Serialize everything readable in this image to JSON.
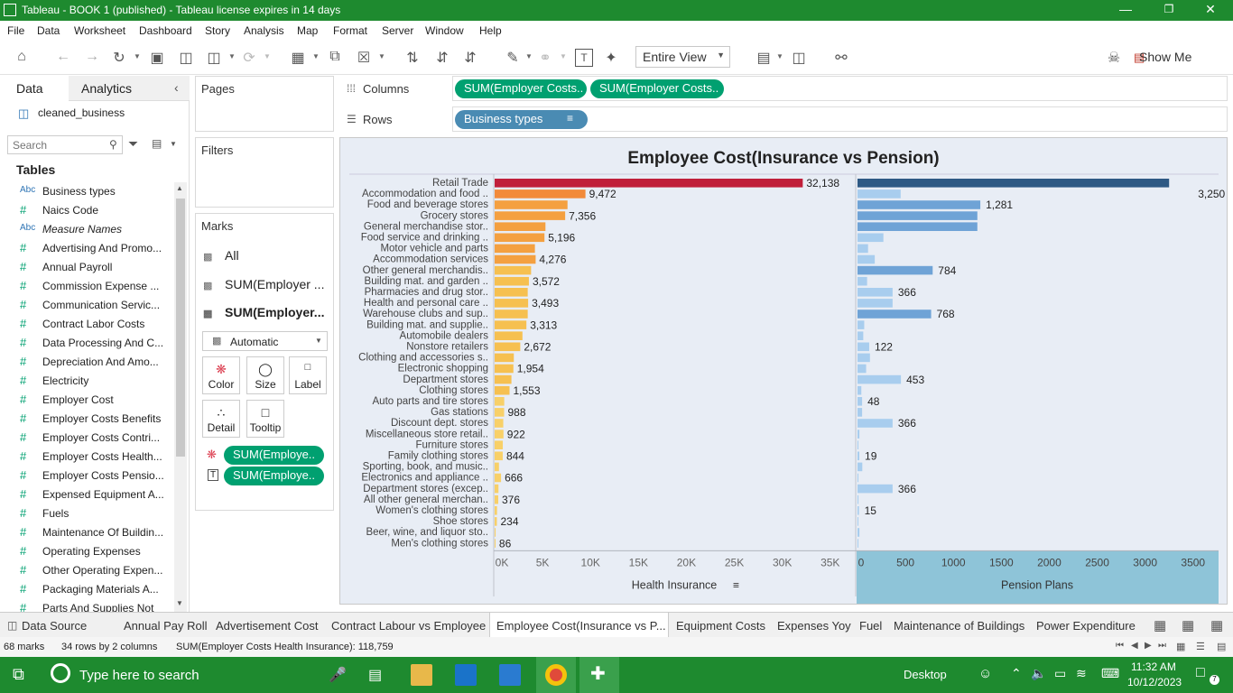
{
  "titlebar": {
    "title": "Tableau - BOOK 1 (published) - Tableau license expires in 14 days"
  },
  "menu": [
    "File",
    "Data",
    "Worksheet",
    "Dashboard",
    "Story",
    "Analysis",
    "Map",
    "Format",
    "Server",
    "Window",
    "Help"
  ],
  "toolbar": {
    "view_mode": "Entire View",
    "show_me": "Show Me"
  },
  "left": {
    "tab_data": "Data",
    "tab_analytics": "Analytics",
    "datasource": "cleaned_business",
    "search_placeholder": "Search",
    "tables_heading": "Tables",
    "fields": [
      {
        "icon": "Abc",
        "name": "Business types",
        "italic": false
      },
      {
        "icon": "#",
        "name": "Naics Code",
        "italic": false
      },
      {
        "icon": "Abc",
        "name": "Measure Names",
        "italic": true
      },
      {
        "icon": "#",
        "name": "Advertising And Promo...",
        "italic": false
      },
      {
        "icon": "#",
        "name": "Annual Payroll",
        "italic": false
      },
      {
        "icon": "#",
        "name": "Commission Expense ...",
        "italic": false
      },
      {
        "icon": "#",
        "name": "Communication Servic...",
        "italic": false
      },
      {
        "icon": "#",
        "name": "Contract Labor Costs",
        "italic": false
      },
      {
        "icon": "#",
        "name": "Data Processing And C...",
        "italic": false
      },
      {
        "icon": "#",
        "name": "Depreciation And Amo...",
        "italic": false
      },
      {
        "icon": "#",
        "name": "Electricity",
        "italic": false
      },
      {
        "icon": "#",
        "name": "Employer Cost",
        "italic": false
      },
      {
        "icon": "#",
        "name": "Employer Costs Benefits",
        "italic": false
      },
      {
        "icon": "#",
        "name": "Employer Costs Contri...",
        "italic": false
      },
      {
        "icon": "#",
        "name": "Employer Costs Health...",
        "italic": false
      },
      {
        "icon": "#",
        "name": "Employer Costs Pensio...",
        "italic": false
      },
      {
        "icon": "#",
        "name": "Expensed Equipment A...",
        "italic": false
      },
      {
        "icon": "#",
        "name": "Fuels",
        "italic": false
      },
      {
        "icon": "#",
        "name": "Maintenance Of Buildin...",
        "italic": false
      },
      {
        "icon": "#",
        "name": "Operating Expenses",
        "italic": false
      },
      {
        "icon": "#",
        "name": "Other Operating Expen...",
        "italic": false
      },
      {
        "icon": "#",
        "name": "Packaging Materials A...",
        "italic": false
      },
      {
        "icon": "#",
        "name": "Parts And Supplies Not",
        "italic": false
      }
    ]
  },
  "cards": {
    "pages": "Pages",
    "filters": "Filters",
    "marks": "Marks",
    "marks_all": "All",
    "marks_sum1": "SUM(Employer ...",
    "marks_sum2": "SUM(Employer...",
    "mark_type": "Automatic",
    "buttons": {
      "color": "Color",
      "size": "Size",
      "label": "Label",
      "detail": "Detail",
      "tooltip": "Tooltip"
    },
    "pill1": "SUM(Employe..",
    "pill2": "SUM(Employe.."
  },
  "shelves": {
    "columns_label": "Columns",
    "rows_label": "Rows",
    "col_pill1": "SUM(Employer Costs..",
    "col_pill2": "SUM(Employer Costs..",
    "row_pill": "Business types"
  },
  "chart_data": {
    "type": "bar",
    "title": "Employee Cost(Insurance vs Pension)",
    "categories": [
      "Retail Trade",
      "Accommodation and food ..",
      "Food and beverage stores",
      "Grocery stores",
      "General merchandise stor..",
      "Food service and drinking ..",
      "Motor vehicle and parts",
      "Accommodation services",
      "Other general merchandis..",
      "Building mat. and garden ..",
      "Pharmacies and drug stor..",
      "Health and personal care ..",
      "Warehouse clubs and sup..",
      "Building mat. and supplie..",
      "Automobile dealers",
      "Nonstore retailers",
      "Clothing and accessories s..",
      "Electronic shopping",
      "Department stores",
      "Clothing stores",
      "Auto parts and tire stores",
      "Gas stations",
      "Discount dept. stores",
      "Miscellaneous store retail..",
      "Furniture stores",
      "Family clothing stores",
      "Sporting, book, and music..",
      "Electronics and appliance ..",
      "Department stores (excep..",
      "All other general merchan..",
      "Women's clothing stores",
      "Shoe stores",
      "Beer, wine, and liquor sto..",
      "Men's clothing stores"
    ],
    "series": [
      {
        "name": "Health Insurance",
        "xlim": [
          0,
          37000
        ],
        "ticks": [
          "0K",
          "5K",
          "10K",
          "15K",
          "20K",
          "25K",
          "30K",
          "35K"
        ],
        "values": [
          32138,
          9472,
          7600,
          7356,
          5300,
          5196,
          4200,
          4276,
          3800,
          3572,
          3450,
          3493,
          3450,
          3313,
          2900,
          2672,
          2000,
          1954,
          1750,
          1553,
          1000,
          988,
          900,
          922,
          850,
          844,
          450,
          666,
          400,
          376,
          250,
          234,
          100,
          86
        ],
        "labels": [
          "32,138",
          "9,472",
          "",
          "7,356",
          "",
          "5,196",
          "",
          "4,276",
          "",
          "3,572",
          "",
          "3,493",
          "",
          "3,313",
          "",
          "2,672",
          "",
          "1,954",
          "",
          "1,553",
          "",
          "988",
          "",
          "922",
          "",
          "844",
          "",
          "666",
          "",
          "376",
          "",
          "234",
          "",
          "86"
        ]
      },
      {
        "name": "Pension Plans",
        "xlim": [
          0,
          3700
        ],
        "ticks": [
          "0",
          "500",
          "1000",
          "1500",
          "2000",
          "2500",
          "3000",
          "3500"
        ],
        "values": [
          3250,
          450,
          1281,
          1250,
          1250,
          270,
          110,
          180,
          784,
          100,
          366,
          366,
          768,
          70,
          60,
          122,
          130,
          90,
          453,
          40,
          48,
          48,
          366,
          20,
          5,
          19,
          50,
          5,
          366,
          10,
          15,
          5,
          20,
          5
        ],
        "labels": [
          "3,250",
          "",
          "1,281",
          "",
          "",
          "",
          "",
          "",
          "784",
          "",
          "366",
          "",
          "768",
          "",
          "",
          "122",
          "",
          "",
          "453",
          "",
          "48",
          "",
          "366",
          "",
          "",
          "19",
          "",
          "",
          "366",
          "",
          "15",
          "",
          "",
          ""
        ]
      }
    ]
  },
  "bottom_tabs": [
    "Data Source",
    "Annual Pay Roll",
    "Advertisement Cost",
    "Contract Labour vs Employee",
    "Employee Cost(Insurance vs P...",
    "Equipment Costs",
    "Expenses Yoy",
    "Fuel",
    "Maintenance of Buildings",
    "Power Expenditure"
  ],
  "status": {
    "marks": "68 marks",
    "rows": "34 rows by 2 columns",
    "sum": "SUM(Employer Costs Health Insurance): 118,759"
  },
  "taskbar": {
    "search": "Type here to search",
    "desktop": "Desktop",
    "time": "11:32 AM",
    "date": "10/12/2023",
    "notif": "7"
  },
  "colors": {
    "brand": "#1e8a2f",
    "pill": "#00a070",
    "rowpill": "#4a8bb3"
  }
}
